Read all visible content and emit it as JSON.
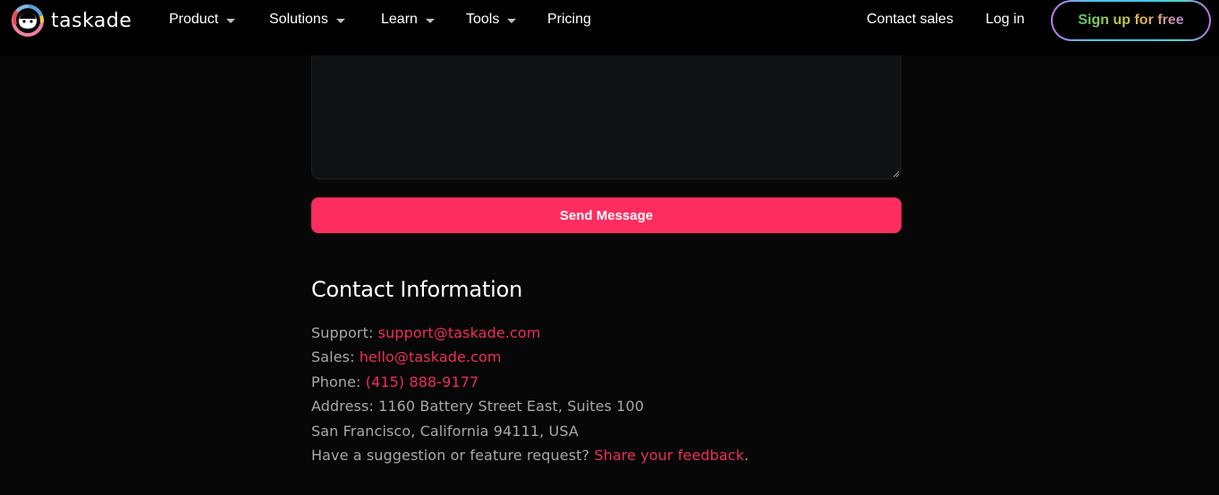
{
  "brand": {
    "name": "taskade",
    "accent": "#ff2d5f",
    "link_color": "#ec2f5b"
  },
  "nav": {
    "items": [
      {
        "label": "Product",
        "has_dropdown": true
      },
      {
        "label": "Solutions",
        "has_dropdown": true
      },
      {
        "label": "Learn",
        "has_dropdown": true
      },
      {
        "label": "Tools",
        "has_dropdown": true
      },
      {
        "label": "Pricing",
        "has_dropdown": false
      }
    ],
    "contact_sales": "Contact sales",
    "login": "Log in",
    "signup": "Sign up for free"
  },
  "form": {
    "message_value": "",
    "send_label": "Send Message"
  },
  "contact": {
    "title": "Contact Information",
    "support_label": "Support: ",
    "support_email": "support@taskade.com",
    "sales_label": "Sales: ",
    "sales_email": "hello@taskade.com",
    "phone_label": "Phone: ",
    "phone": "(415) 888-9177",
    "address_line1": "Address: 1160 Battery Street East, Suites 100",
    "address_line2": "San Francisco, California 94111, USA",
    "feedback_prompt": "Have a suggestion or feature request? ",
    "feedback_link": "Share your feedback",
    "feedback_suffix": "."
  }
}
